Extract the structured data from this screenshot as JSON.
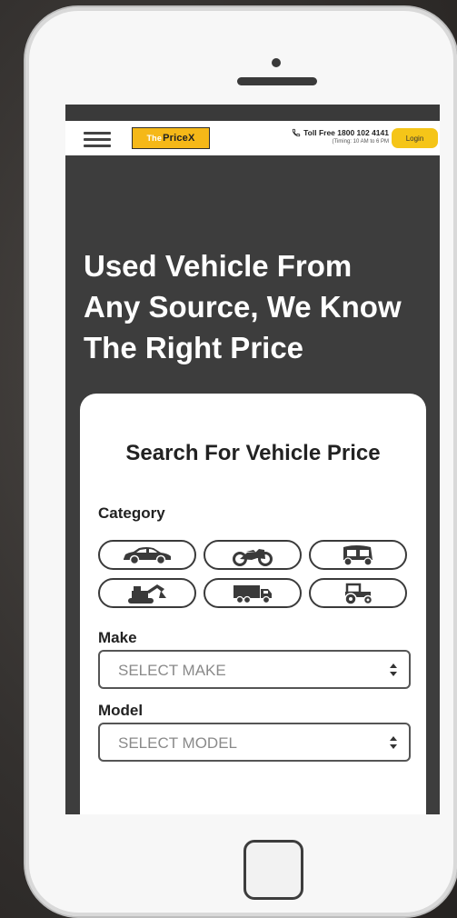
{
  "header": {
    "logo_the": "The",
    "logo_name": "PriceX",
    "toll_free": "Toll Free 1800 102 4141",
    "timing": "(Timing: 10 AM to 6 PM",
    "login_label": "Login"
  },
  "hero": {
    "line1": "Used Vehicle From",
    "line2": "Any Source, We Know",
    "line3": "The Right Price"
  },
  "search": {
    "title": "Search For Vehicle Price",
    "category_label": "Category",
    "categories": [
      "car-icon",
      "motorcycle-icon",
      "auto-rickshaw-icon",
      "excavator-icon",
      "truck-icon",
      "tractor-icon"
    ],
    "make_label": "Make",
    "make_value": "SELECT MAKE",
    "model_label": "Model",
    "model_value": "SELECT MODEL"
  },
  "colors": {
    "accent": "#f5c518",
    "logo": "#f5b818",
    "dark": "#3d3d3d"
  }
}
